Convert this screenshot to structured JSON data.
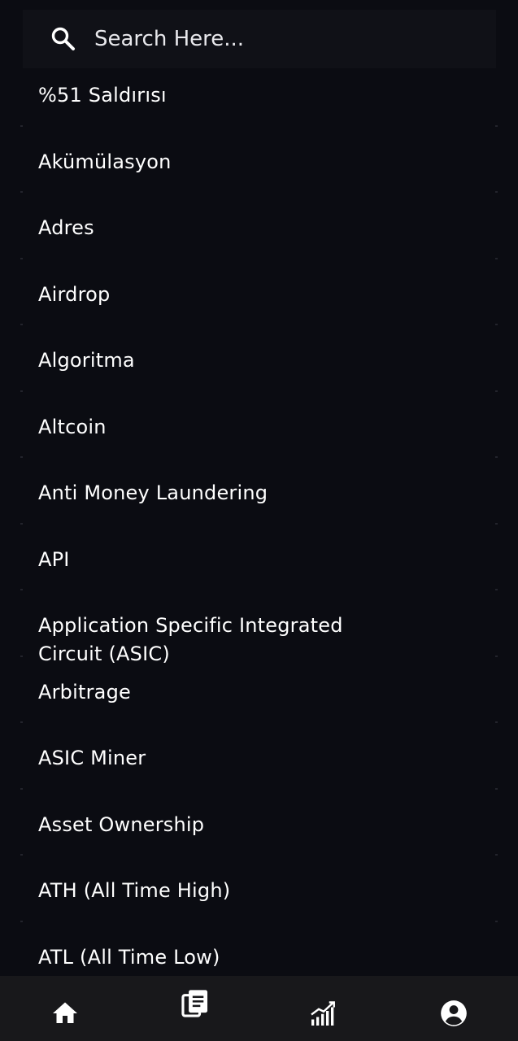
{
  "search": {
    "placeholder": "Search Here..."
  },
  "terms": [
    "%51 Saldırısı",
    "Akümülasyon",
    "Adres",
    "Airdrop",
    "Algoritma",
    "Altcoin",
    "Anti Money Laundering",
    "API",
    "Application Specific Integrated Circuit (ASIC)",
    "Arbitrage",
    "ASIC Miner",
    "Asset Ownership",
    "ATH (All Time High)",
    "ATL (All Time Low)"
  ],
  "nav": {
    "items": [
      {
        "icon": "home-icon"
      },
      {
        "icon": "documents-icon"
      },
      {
        "icon": "chart-icon"
      },
      {
        "icon": "profile-icon"
      }
    ]
  },
  "colors": {
    "background": "#0b0c12",
    "nav_background": "#18181b",
    "text": "#ffffff"
  }
}
